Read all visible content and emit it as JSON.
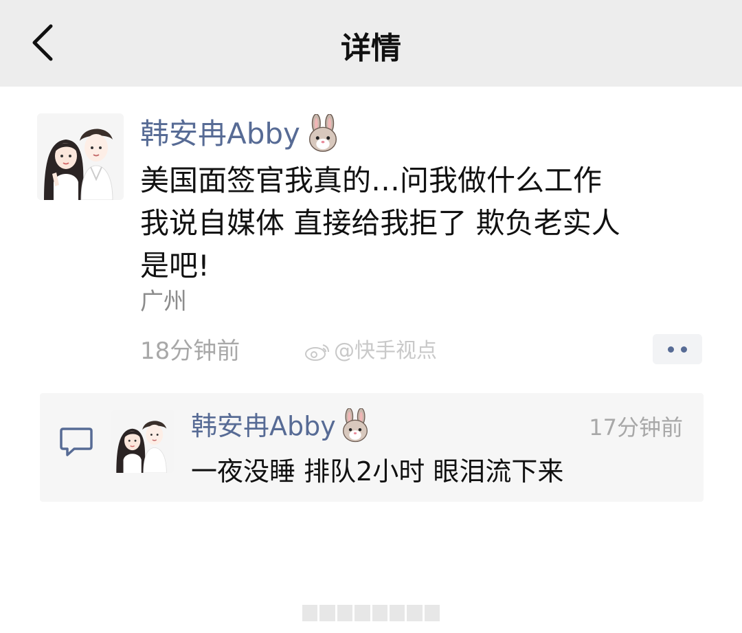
{
  "navbar": {
    "title": "详情",
    "back_icon": "chevron-left-icon"
  },
  "post": {
    "author": "韩安冉Abby",
    "author_emoji": "rabbit-face-icon",
    "avatar": "couple-illustration-avatar",
    "text": "美国面签官我真的…问我做什么工作\n我说自媒体 直接给我拒了 欺负老实人\n是吧!",
    "location": "广州",
    "time": "18分钟前",
    "watermark_text": "@快手视点",
    "more_icon": "more-dots-icon"
  },
  "comment": {
    "icon": "comment-bubble-icon",
    "author": "韩安冉Abby",
    "author_emoji": "rabbit-face-icon",
    "time": "17分钟前",
    "text": "一夜没睡 排队2小时 眼泪流下来"
  },
  "colors": {
    "navbar_bg": "#ededed",
    "link_blue": "#576b95",
    "comment_bg": "#f6f6f6",
    "text_primary": "#111111",
    "text_secondary": "#a8a8a8"
  }
}
